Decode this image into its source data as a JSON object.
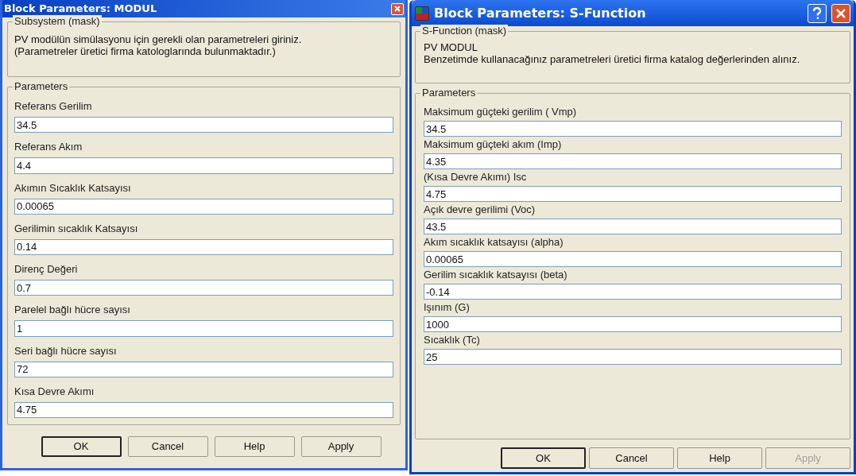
{
  "windows": [
    {
      "title": "Block Parameters: MODUL",
      "kind": "classic",
      "help_button": false,
      "mask": {
        "legend": "Subsystem (mask)",
        "lines": [
          "PV modülün simülasyonu için gerekli olan parametreleri giriniz.",
          "(Parametreler üretici firma katologlarında bulunmaktadır.)"
        ]
      },
      "parameters": {
        "legend": "Parameters",
        "items": [
          {
            "label": "Referans Gerilim",
            "value": "34.5"
          },
          {
            "label": "Referans Akım",
            "value": "4.4"
          },
          {
            "label": "Akımın Sıcaklık Katsayısı",
            "value": "0.00065"
          },
          {
            "label": "Gerilimin sıcaklık Katsayısı",
            "value": "0.14"
          },
          {
            "label": "Direnç Değeri",
            "value": "0.7"
          },
          {
            "label": "Parelel bağlı hücre sayısı",
            "value": "1"
          },
          {
            "label": "Seri bağlı hücre sayısı",
            "value": "72"
          },
          {
            "label": "Kısa Devre Akımı",
            "value": "4.75"
          }
        ]
      },
      "buttons": [
        {
          "label": "OK",
          "disabled": false,
          "default": true
        },
        {
          "label": "Cancel",
          "disabled": false,
          "default": false
        },
        {
          "label": "Help",
          "disabled": false,
          "default": false
        },
        {
          "label": "Apply",
          "disabled": false,
          "default": false
        }
      ]
    },
    {
      "title": "Block Parameters: S-Function",
      "kind": "xp",
      "help_button": true,
      "mask": {
        "legend": "S-Function (mask)",
        "lines": [
          "PV MODUL",
          "Benzetimde kullanacağınız parametreleri üretici firma katalog değerlerinden alınız."
        ]
      },
      "parameters": {
        "legend": "Parameters",
        "items": [
          {
            "label": "Maksimum güçteki gerilim ( Vmp)",
            "value": "34.5"
          },
          {
            "label": "Maksimum güçteki akım (Imp)",
            "value": "4.35"
          },
          {
            "label": "(Kısa Devre Akımı) Isc",
            "value": "4.75"
          },
          {
            "label": "Açık devre gerilimi (Voc)",
            "value": "43.5"
          },
          {
            "label": "Akım sıcaklık katsayısı (alpha)",
            "value": "0.00065"
          },
          {
            "label": "Gerilim sıcaklık katsayısı (beta)",
            "value": "-0.14"
          },
          {
            "label": "Işınım (G)",
            "value": "1000"
          },
          {
            "label": "Sıcaklık (Tc)",
            "value": "25"
          }
        ]
      },
      "buttons": [
        {
          "label": "OK",
          "disabled": false,
          "default": true
        },
        {
          "label": "Cancel",
          "disabled": false,
          "default": false
        },
        {
          "label": "Help",
          "disabled": false,
          "default": false
        },
        {
          "label": "Apply",
          "disabled": true,
          "default": false
        }
      ]
    }
  ]
}
